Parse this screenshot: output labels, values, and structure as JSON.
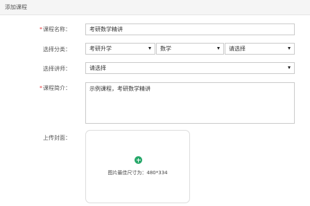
{
  "header": {
    "title": "添加课程"
  },
  "form": {
    "course_name": {
      "label": "课程名称：",
      "required": true,
      "value": "考研数学精讲"
    },
    "category": {
      "label": "选择分类：",
      "select1": "考研升学",
      "select2": "数学",
      "select3": "请选择"
    },
    "teacher": {
      "label": "选择讲师：",
      "value": "请选择"
    },
    "intro": {
      "label": "课程简介：",
      "required": true,
      "value": "示例课程，考研数学精讲"
    },
    "cover": {
      "label": "上传封面：",
      "hint": "图片最佳尺寸为：480*334"
    }
  },
  "colors": {
    "required_mark": "#e5383b",
    "upload_plus": "#27a86a"
  },
  "icons": {
    "select_caret": "caret-down-icon",
    "upload": "plus-circle-icon"
  }
}
